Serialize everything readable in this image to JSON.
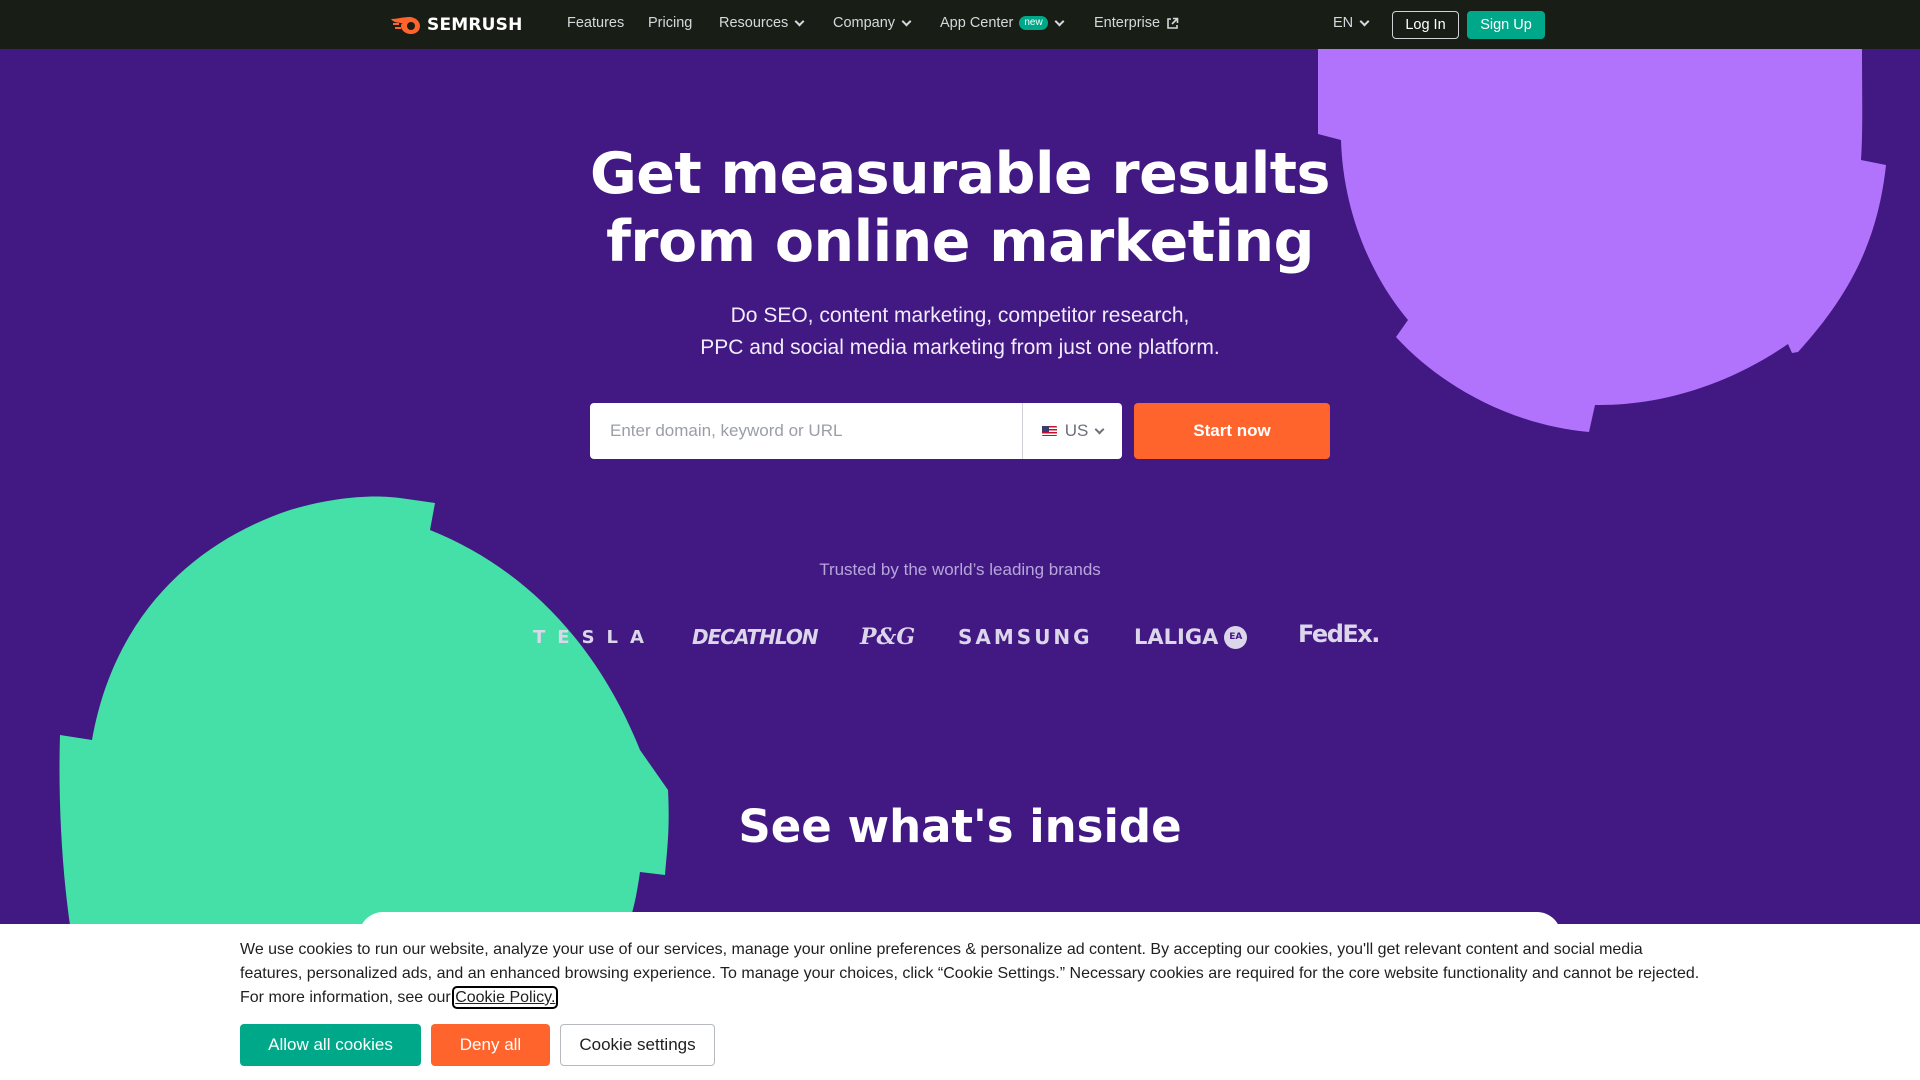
{
  "colors": {
    "background": "#421983",
    "topbar": "#181e15",
    "accent_green": "#00a88a",
    "accent_orange": "#ff642d",
    "deco_purple": "#b173fb",
    "deco_green": "#45e0a8"
  },
  "nav": {
    "logo_text": "SEMRUSH",
    "items": {
      "features": "Features",
      "pricing": "Pricing",
      "resources": "Resources",
      "company": "Company",
      "app_center": "App Center",
      "app_center_badge": "new",
      "enterprise": "Enterprise"
    },
    "language": "EN",
    "login": "Log In",
    "signup": "Sign Up"
  },
  "hero": {
    "title_line1": "Get measurable results",
    "title_line2": "from online marketing",
    "subtitle_line1": "Do SEO, content marketing, competitor research,",
    "subtitle_line2": "PPC and social media marketing from just one platform.",
    "search_placeholder": "Enter domain, keyword or URL",
    "country": "US",
    "start_button": "Start now"
  },
  "brands": {
    "heading": "Trusted by the world’s leading brands",
    "tesla": "TESLA",
    "decathlon": "DECATHLON",
    "pg": "P&G",
    "samsung": "SAMSUNG",
    "laliga": "LALIGA",
    "laliga_badge": "EA",
    "fedex": "FedEx."
  },
  "section": {
    "title": "See what's inside"
  },
  "cookie": {
    "text": "We use cookies to run our website, analyze your use of our services, manage your online preferences & personalize ad content. By accepting our cookies, you'll get relevant content and social media features, personalized ads, and an enhanced browsing experience. To manage your choices, click “Cookie Settings.” Necessary cookies are required for the core website functionality and cannot be rejected. For more information, see our ",
    "link": "Cookie Policy.",
    "allow": "Allow all cookies",
    "deny": "Deny all",
    "settings": "Cookie settings"
  }
}
